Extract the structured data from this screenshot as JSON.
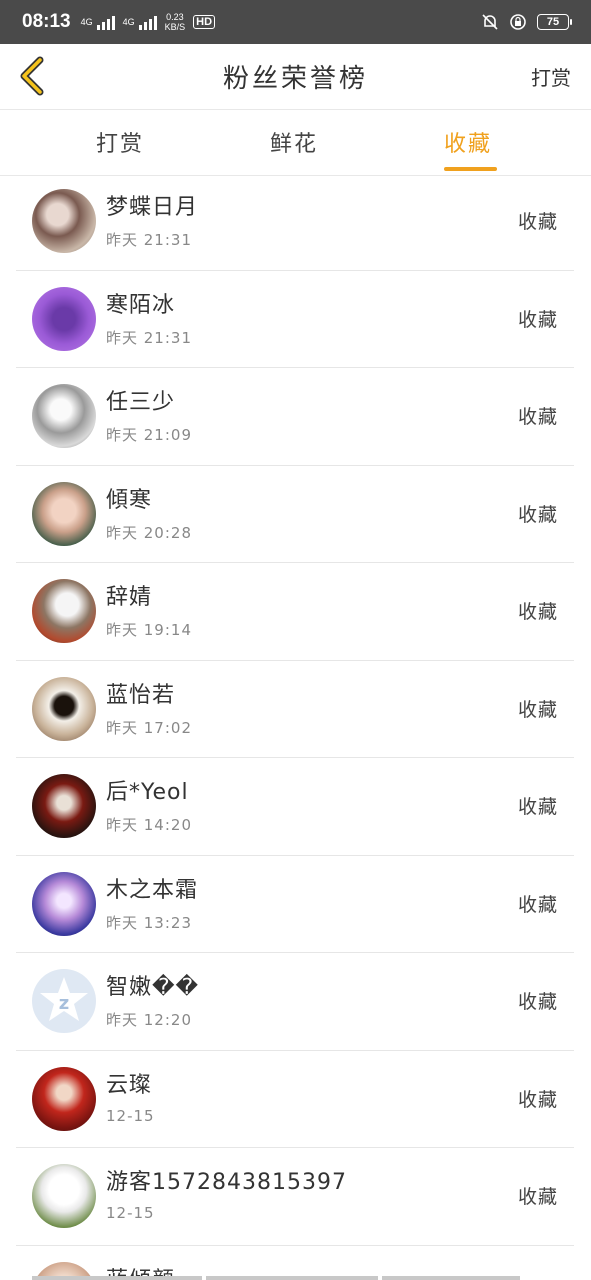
{
  "status_bar": {
    "time": "08:13",
    "net1": "4G",
    "net2": "4G",
    "speed_value": "0.23",
    "speed_unit": "KB/S",
    "hd": "HD",
    "battery": "75"
  },
  "nav": {
    "title": "粉丝荣誉榜",
    "action": "打赏"
  },
  "tabs": [
    {
      "label": "打赏"
    },
    {
      "label": "鲜花"
    },
    {
      "label": "收藏"
    }
  ],
  "active_tab": "收藏",
  "accent_color": "#f0a11e",
  "rows": [
    {
      "name": "梦蝶日月",
      "time": "昨天 21:31",
      "kind": "收藏"
    },
    {
      "name": "寒陌冰",
      "time": "昨天 21:31",
      "kind": "收藏"
    },
    {
      "name": "任三少",
      "time": "昨天 21:09",
      "kind": "收藏"
    },
    {
      "name": "傾寒",
      "time": "昨天 20:28",
      "kind": "收藏"
    },
    {
      "name": "辞婧",
      "time": "昨天 19:14",
      "kind": "收藏"
    },
    {
      "name": "蓝怡若",
      "time": "昨天 17:02",
      "kind": "收藏"
    },
    {
      "name": "后*Yeol",
      "time": "昨天 14:20",
      "kind": "收藏"
    },
    {
      "name": "木之本霜",
      "time": "昨天 13:23",
      "kind": "收藏"
    },
    {
      "name": "智嫩��",
      "time": "昨天 12:20",
      "kind": "收藏"
    },
    {
      "name": "云璨",
      "time": "12-15",
      "kind": "收藏"
    },
    {
      "name": "游客1572843815397",
      "time": "12-15",
      "kind": "收藏"
    },
    {
      "name": "蓝倾颜",
      "time": "",
      "kind": ""
    }
  ]
}
